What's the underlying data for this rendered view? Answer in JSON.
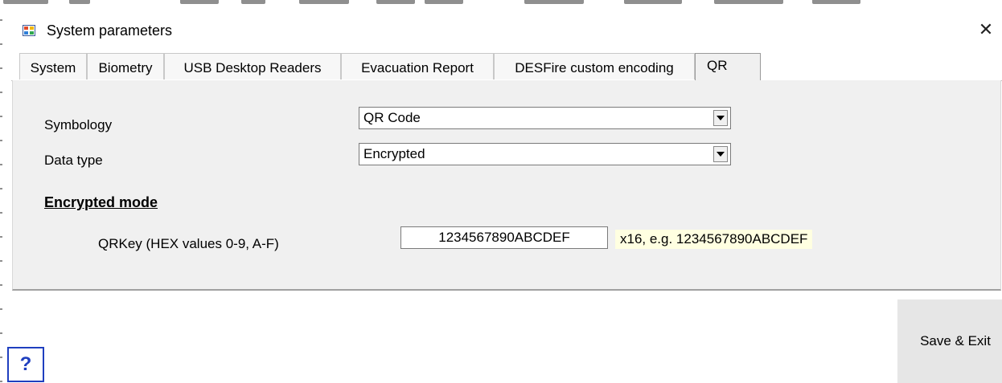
{
  "window": {
    "title": "System parameters",
    "close_glyph": "✕"
  },
  "tabs": [
    {
      "label": "System"
    },
    {
      "label": "Biometry"
    },
    {
      "label": "USB Desktop Readers"
    },
    {
      "label": "Evacuation Report"
    },
    {
      "label": "DESFire custom encoding"
    },
    {
      "label": "QR",
      "active": true
    }
  ],
  "form": {
    "symbology_label": "Symbology",
    "symbology_value": "QR Code",
    "datatype_label": "Data type",
    "datatype_value": "Encrypted",
    "section_title": "Encrypted mode",
    "qrkey_label": "QRKey (HEX values 0-9, A-F)",
    "qrkey_value": "1234567890ABCDEF",
    "qrkey_hint": "x16, e.g. 1234567890ABCDEF"
  },
  "buttons": {
    "save_exit": "Save & Exit",
    "help": "?"
  },
  "colors": {
    "hint_bg": "#ffffe1",
    "help_blue": "#1f3fbf",
    "panel_bg": "#f0f0f0"
  }
}
